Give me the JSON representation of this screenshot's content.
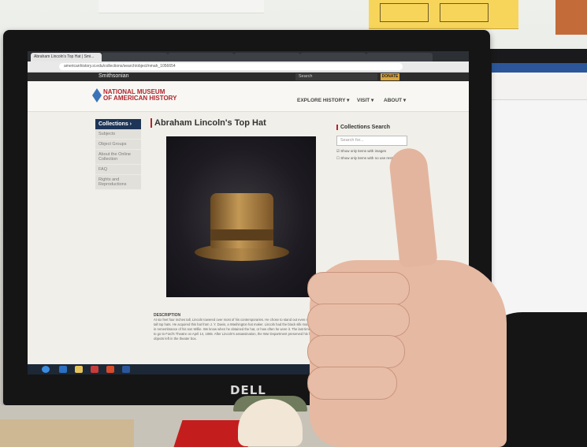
{
  "browser": {
    "tabs": [
      "Abraham Lincoln's Top Hat | Smi...",
      "",
      "",
      "",
      "",
      ""
    ],
    "url": "americanhistory.si.edu/collections/search/object/nmah_1056654"
  },
  "site": {
    "smithsonian": "Smithsonian",
    "search_placeholder": "Search",
    "donate": "DONATE",
    "museum_line1": "NATIONAL MUSEUM",
    "museum_line2": "OF AMERICAN HISTORY",
    "nav": [
      "EXPLORE HISTORY ▾",
      "VISIT ▾",
      "ABOUT ▾"
    ]
  },
  "sidebar": {
    "heading": "Collections ›",
    "items": [
      "Subjects",
      "Object Groups",
      "About the Online Collection",
      "FAQ",
      "Rights and Reproductions"
    ]
  },
  "page": {
    "title": "Abraham Lincoln's Top Hat",
    "description_heading": "DESCRIPTION",
    "description": "At six feet four inches tall, Lincoln towered over most of his contemporaries. He chose to stand out even more by wearing tall top hats. He acquired this hat from J. Y. Davis, a Washington hat maker. Lincoln had the black silk mourning band added in remembrance of his son Willie. We know when he obtained the hat, or how often he wore it. The last time he put it on was to go to Ford's Theatre on April 14, 1865. After Lincoln's assassination, the War Department preserved his hat and other objects left in the theater box."
  },
  "collections_search": {
    "title": "Collections Search",
    "placeholder": "Search for...",
    "option1": "Show only items with images",
    "option2": "Show only items with no use restrictions"
  },
  "monitor_brand": "DELL"
}
